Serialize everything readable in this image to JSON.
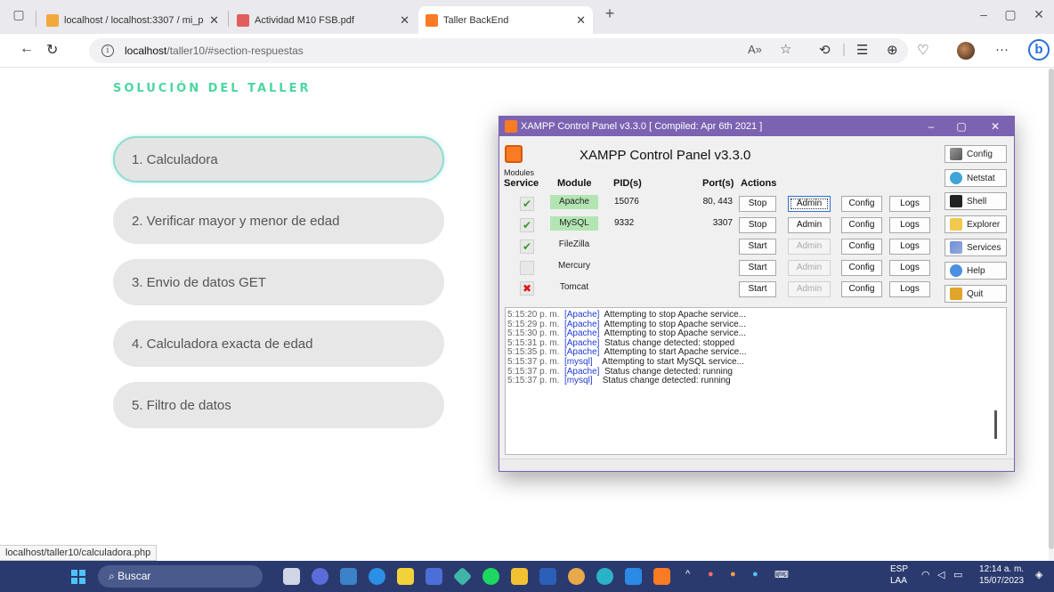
{
  "browser": {
    "tabs": [
      {
        "label": "localhost / localhost:3307 / mi_p",
        "icon": "phpmyadmin-icon"
      },
      {
        "label": "Actividad M10 FSB.pdf",
        "icon": "pdf-icon"
      },
      {
        "label": "Taller BackEnd",
        "icon": "xampp-icon"
      }
    ],
    "tab_close": "✕",
    "new_tab": "+",
    "url_host": "localhost",
    "url_path": "/taller10/#section-respuestas",
    "status_url": "localhost/taller10/calculadora.php"
  },
  "page": {
    "title": "SOLUCIÓN DEL TALLER",
    "items": [
      "1. Calculadora",
      "2. Verificar mayor y menor de edad",
      "3. Envio de datos GET",
      "4. Calculadora exacta de edad",
      "5. Filtro de datos"
    ]
  },
  "xampp": {
    "window_title": "XAMPP Control Panel v3.3.0   [ Compiled: Apr 6th 2021 ]",
    "heading": "XAMPP Control Panel v3.3.0",
    "modules_label": "Modules",
    "headers": {
      "service": "Service",
      "module": "Module",
      "pid": "PID(s)",
      "ports": "Port(s)",
      "actions": "Actions"
    },
    "modules": [
      {
        "name": "Apache",
        "pid": "15076",
        "ports": "80, 443",
        "action": "Stop",
        "service": "ok",
        "running": true
      },
      {
        "name": "MySQL",
        "pid": "9332",
        "ports": "3307",
        "action": "Stop",
        "service": "ok",
        "running": true
      },
      {
        "name": "FileZilla",
        "pid": "",
        "ports": "",
        "action": "Start",
        "service": "ok",
        "running": false
      },
      {
        "name": "Mercury",
        "pid": "",
        "ports": "",
        "action": "Start",
        "service": "none",
        "running": false
      },
      {
        "name": "Tomcat",
        "pid": "",
        "ports": "",
        "action": "Start",
        "service": "error",
        "running": false
      }
    ],
    "buttons": {
      "admin": "Admin",
      "config": "Config",
      "logs": "Logs"
    },
    "side_buttons": [
      "Config",
      "Netstat",
      "Shell",
      "Explorer",
      "Services",
      "Help",
      "Quit"
    ],
    "log": [
      {
        "time": "5:15:20 p. m.",
        "module": "[Apache]",
        "msg": "Attempting to stop Apache service..."
      },
      {
        "time": "5:15:29 p. m.",
        "module": "[Apache]",
        "msg": "Attempting to stop Apache service..."
      },
      {
        "time": "5:15:30 p. m.",
        "module": "[Apache]",
        "msg": "Attempting to stop Apache service..."
      },
      {
        "time": "5:15:31 p. m.",
        "module": "[Apache]",
        "msg": "Status change detected: stopped"
      },
      {
        "time": "5:15:35 p. m.",
        "module": "[Apache]",
        "msg": "Attempting to start Apache service..."
      },
      {
        "time": "5:15:37 p. m.",
        "module": "[mysql]",
        "msg": "Attempting to start MySQL service..."
      },
      {
        "time": "5:15:37 p. m.",
        "module": "[Apache]",
        "msg": "Status change detected: running"
      },
      {
        "time": "5:15:37 p. m.",
        "module": "[mysql]",
        "msg": "Status change detected: running"
      }
    ]
  },
  "taskbar": {
    "search": "Buscar",
    "lang": "ESP",
    "region": "LAA",
    "time": "12:14 a. m.",
    "date": "15/07/2023"
  },
  "colors": {
    "accent_green": "#4cd6a0",
    "xampp_purple": "#7b63b2",
    "xampp_orange": "#fb7a24",
    "taskbar": "#2a3a6e"
  }
}
